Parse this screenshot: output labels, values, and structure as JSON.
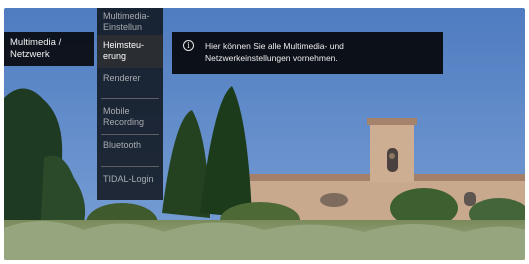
{
  "left_menu": {
    "label_line1": "Multimedia /",
    "label_line2": "Netzwerk"
  },
  "sub_menu": {
    "items": [
      {
        "line1": "Multimedia-",
        "line2": "Einstellun"
      },
      {
        "line1": "Heimsteu-",
        "line2": "erung"
      },
      {
        "line1": "Renderer",
        "line2": ""
      },
      {
        "line1": "Mobile",
        "line2": "Recording"
      },
      {
        "line1": "Bluetooth",
        "line2": ""
      },
      {
        "line1": "TIDAL-Login",
        "line2": ""
      }
    ]
  },
  "info": {
    "icon": "info-icon",
    "line1": "Hier können Sie alle Multimedia- und",
    "line2": "Netzwerkeinstellungen vornehmen."
  },
  "colors": {
    "sky": "#5d86c6",
    "menu_bg": "#0a0c10",
    "active_item": "#2a2d31"
  }
}
